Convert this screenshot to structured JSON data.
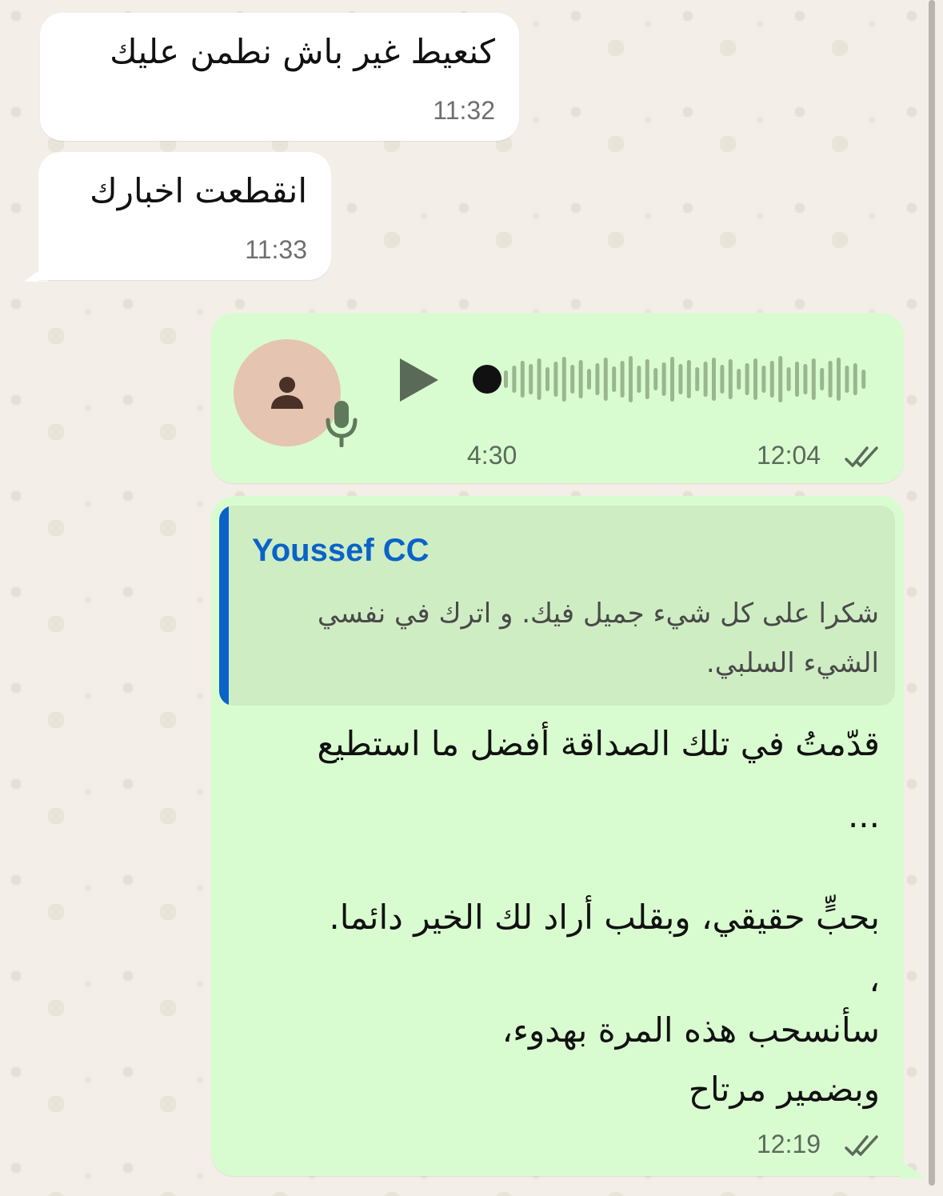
{
  "messages": {
    "incoming_1": {
      "text": "كنعيط غير باش نطمن عليك",
      "time": "11:32"
    },
    "incoming_2": {
      "text": "انقطعت اخبارك",
      "time": "11:33"
    },
    "voice_message": {
      "duration": "4:30",
      "time": "12:04",
      "status_icon": "double-check-icon"
    },
    "reply_message": {
      "quoted_author": "Youssef CC",
      "quoted_text": "شكرا على كل شيء جميل فيك. و اترك في نفسي الشيء السلبي.",
      "lines": [
        "قدّمتُ في تلك الصداقة أفضل ما استطيع",
        "...",
        "بحبٍّ حقيقي، وبقلب أراد لك الخير دائما.",
        "،",
        "سأنسحب هذه المرة بهدوء،",
        "وبضمير مرتاح"
      ],
      "time": "12:19",
      "status_icon": "double-check-icon"
    }
  },
  "colors": {
    "wallpaper": "#f3efe8",
    "incoming_bubble": "#ffffff",
    "outgoing_bubble": "#d9fbd0",
    "quote_bar": "#0a63c8",
    "quote_author": "#0a63c8"
  }
}
